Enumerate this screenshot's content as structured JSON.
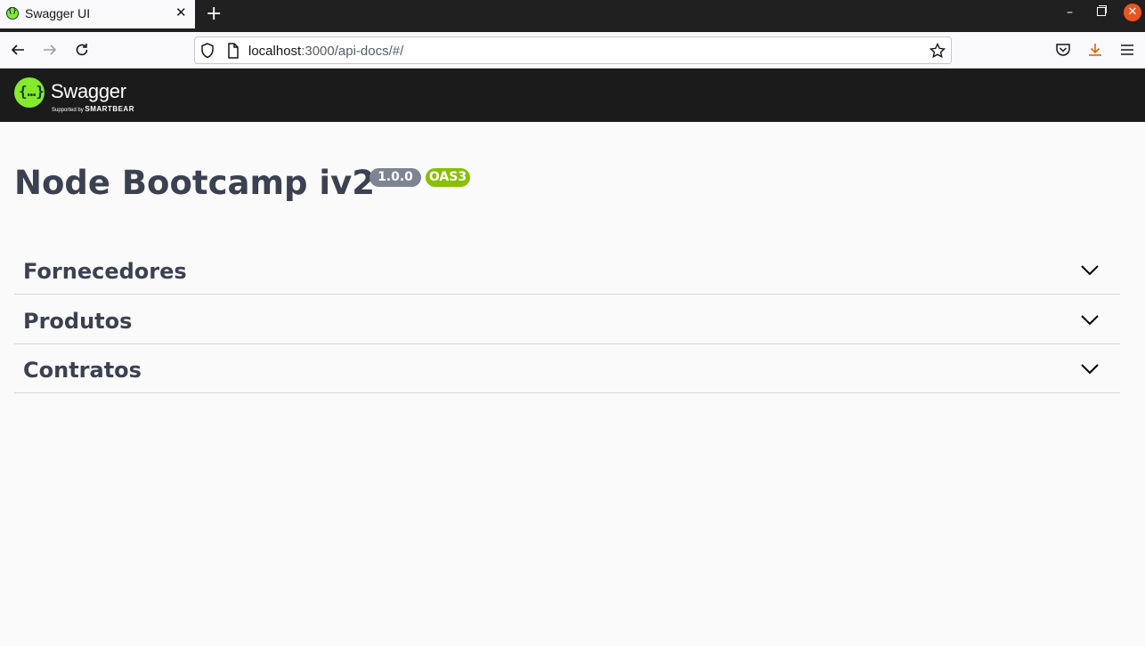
{
  "browser": {
    "tab_title": "Swagger UI",
    "url_host": "localhost",
    "url_rest": ":3000/api-docs/#/"
  },
  "swagger": {
    "brand": "Swagger",
    "tagline_prefix": "Supported by",
    "tagline_brand": "SMARTBEAR",
    "logo_glyph": "{…}"
  },
  "info": {
    "title": "Node Bootcamp iv2",
    "version": "1.0.0",
    "oas": "OAS3"
  },
  "tags": [
    {
      "label": "Fornecedores"
    },
    {
      "label": "Produtos"
    },
    {
      "label": "Contratos"
    }
  ],
  "colors": {
    "swagger_green": "#85ea2d",
    "header_bg": "#1b1b1b",
    "text_dark": "#3b4151",
    "badge_version": "#7d8492",
    "badge_oas": "#89bf04"
  }
}
